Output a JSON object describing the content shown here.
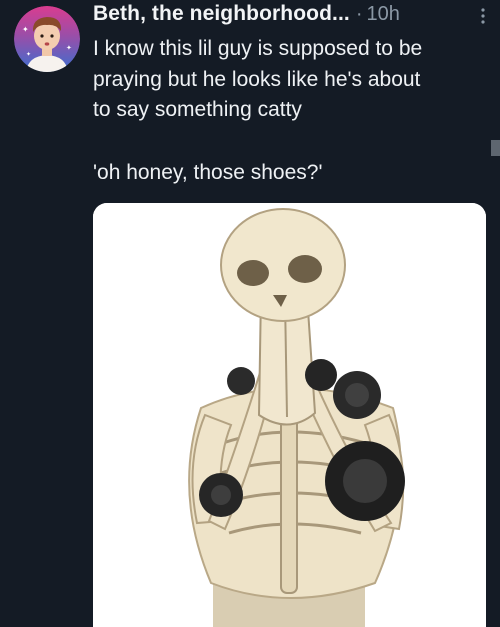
{
  "tweet": {
    "author_name": "Beth, the neighborhood...",
    "separator": "·",
    "timestamp": "10h",
    "more_icon": "more-vertical-icon",
    "lines": [
      "I know this lil guy is supposed to be",
      "praying but he looks like he's about",
      "to say something catty"
    ],
    "quote": "'oh honey, those shoes?'",
    "media_alt": "skeleton figurine with praying hands and black roses"
  },
  "colors": {
    "background": "#141b25",
    "text": "#eef1f4",
    "muted": "#8b98a5"
  }
}
